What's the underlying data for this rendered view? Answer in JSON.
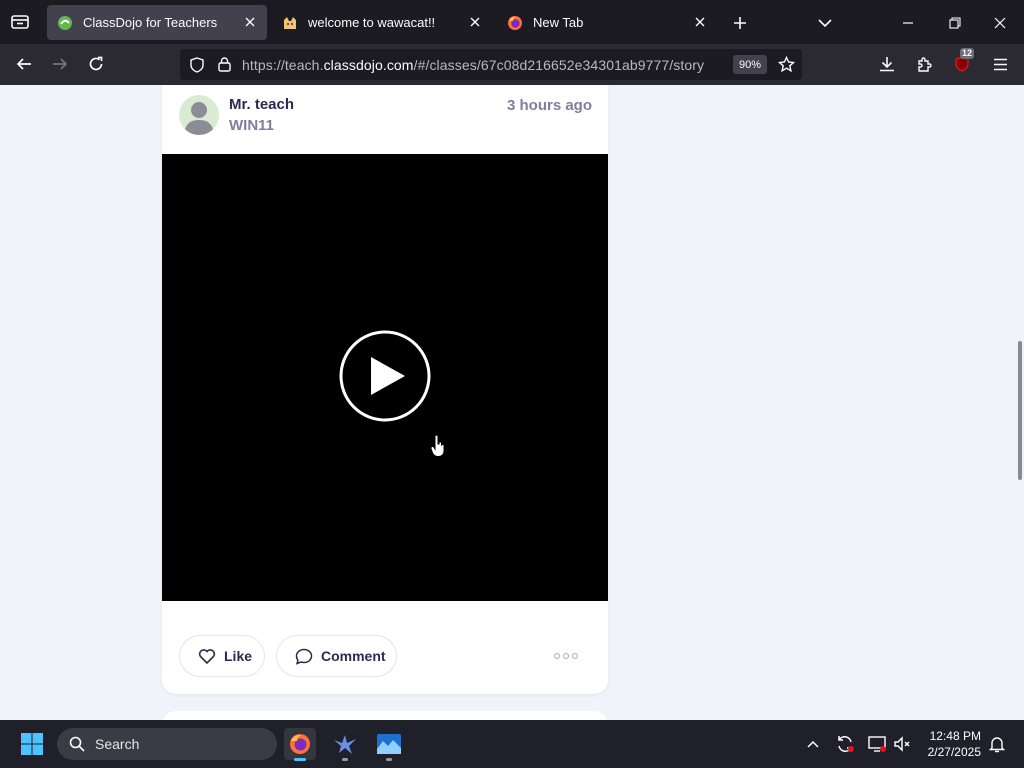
{
  "browser": {
    "tabs": [
      {
        "title": "ClassDojo for Teachers",
        "active": true,
        "favicon": "classdojo-icon"
      },
      {
        "title": "welcome to wawacat!!",
        "active": false,
        "favicon": "cat-icon"
      },
      {
        "title": "New Tab",
        "active": false,
        "favicon": "firefox-icon"
      }
    ],
    "url_prefix": "https://teach.",
    "url_host": "classdojo.com",
    "url_path": "/#/classes/67c08d216652e34301ab9777/story",
    "zoom": "90%",
    "extension_badge": "12"
  },
  "post": {
    "author": "Mr. teach",
    "class_name": "WIN11",
    "time_ago": "3 hours ago",
    "like_label": "Like",
    "comment_label": "Comment"
  },
  "taskbar": {
    "search_placeholder": "Search",
    "time": "12:48 PM",
    "date": "2/27/2025"
  },
  "colors": {
    "accent": "#2c2a50",
    "muted": "#7d7f9e",
    "page_bg": "#f1f3fa"
  }
}
